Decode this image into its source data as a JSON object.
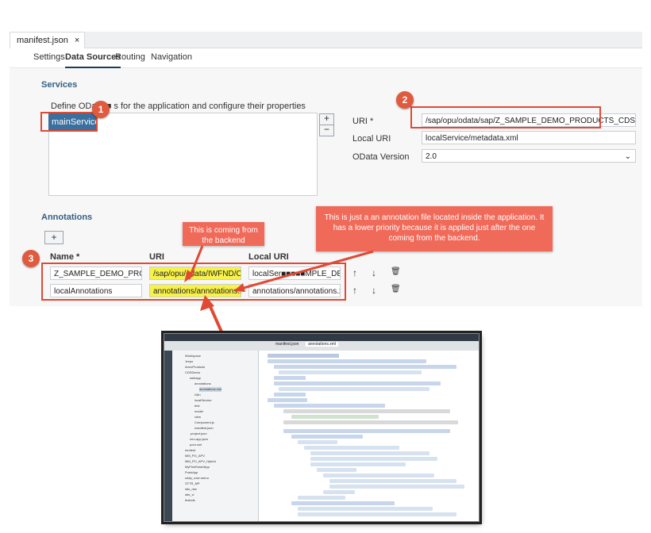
{
  "file_tab": {
    "label": "manifest.json",
    "close": "×"
  },
  "subtabs": [
    "Settings",
    "Data Sources",
    "Routing",
    "Navigation"
  ],
  "active_subtab": "Data Sources",
  "services": {
    "title": "Services",
    "description": "Define OData ■ s for the application and configure their properties",
    "items": [
      "mainService"
    ],
    "add_label": "+",
    "remove_label": "−",
    "uri_label": "URI *",
    "uri_value": "/sap/opu/odata/sap/Z_SAMPLE_DEMO_PRODUCTS_CDS/",
    "local_uri_label": "Local URI",
    "local_uri_value": "localService/metadata.xml",
    "odata_version_label": "OData Version",
    "odata_version_value": "2.0"
  },
  "annotations": {
    "title": "Annotations",
    "add_label": "+",
    "columns": [
      "Name *",
      "URI",
      "Local URI"
    ],
    "rows": [
      {
        "name": "Z_SAMPLE_DEMO_PRODUC",
        "uri": "/sap/opu/odata/IWFND/CATAL",
        "local_uri": "localSer■■■■■MPLE_DEM"
      },
      {
        "name": "localAnnotations",
        "uri": "annotations/annotations.xml",
        "local_uri": "annotations/annotations.xml"
      }
    ],
    "up_icon": "↑",
    "down_icon": "↓",
    "delete_icon": "🗑"
  },
  "badges": [
    "1",
    "2",
    "3"
  ],
  "callouts": {
    "backend": "This is coming from the backend",
    "annotation_file": "This is just a an annotation file located inside the application. It has a lower priority because it is applied just after the one coming from the backend."
  },
  "ide": {
    "tabs": [
      "manifest.json",
      "annotations.xml"
    ],
    "tree": [
      "Workspace",
      "1repo",
      "AnnoProducts",
      "CDSDemo",
      "webapp",
      "annotations",
      "annotations.xml",
      "i18n",
      "localService",
      "test",
      "model",
      "view",
      "Component.js",
      "manifest.json",
      ".project.json",
      "neo-app.json",
      "pom.xml",
      "mmtest",
      "MM_PO_APV",
      "MM_PO_APV_Hybrid",
      "MyFirstSmartApp",
      "PushApp",
      "s4dp_rose.menu",
      "STTR_MP",
      "stts_rise",
      "stts_vl",
      "testcds"
    ]
  },
  "colors": {
    "accent": "#355f84",
    "selection": "#3a6f9e",
    "annotation_red": "#e04a35",
    "callout": "#f06a5a",
    "highlight": "#f7f24a"
  }
}
